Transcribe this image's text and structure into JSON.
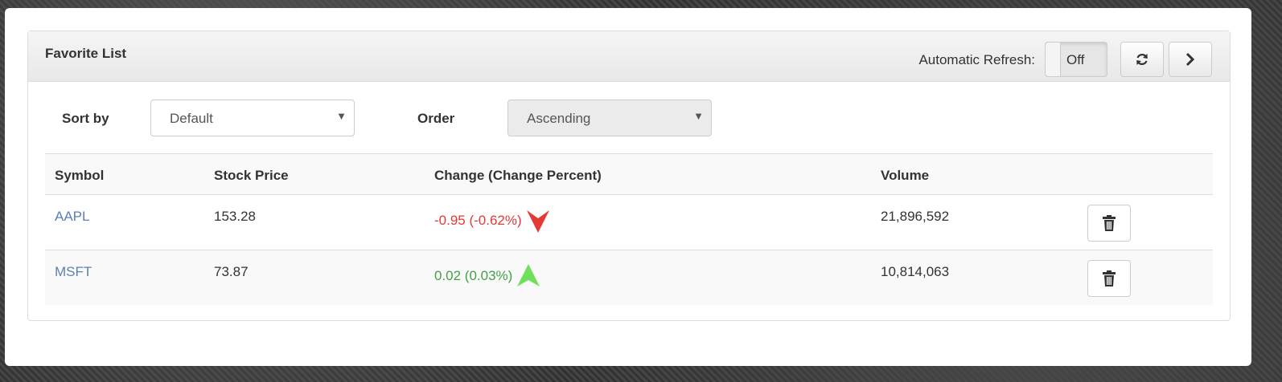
{
  "panel": {
    "title": "Favorite List",
    "auto_refresh_label": "Automatic Refresh:",
    "toggle_state": "Off",
    "refresh_icon": "refresh-icon",
    "next_icon": "chevron-right-icon"
  },
  "filters": {
    "sort_label": "Sort by",
    "sort_value": "Default",
    "order_label": "Order",
    "order_value": "Ascending"
  },
  "table": {
    "headers": {
      "symbol": "Symbol",
      "price": "Stock Price",
      "change": "Change (Change Percent)",
      "volume": "Volume"
    },
    "rows": [
      {
        "symbol": "AAPL",
        "price": "153.28",
        "change": "-0.95 (-0.62%)",
        "direction": "down",
        "volume": "21,896,592"
      },
      {
        "symbol": "MSFT",
        "price": "73.87",
        "change": "0.02 (0.03%)",
        "direction": "up",
        "volume": "10,814,063"
      }
    ]
  },
  "colors": {
    "negative": "#e53935",
    "positive": "#43a047",
    "link": "#5b7fb5"
  }
}
